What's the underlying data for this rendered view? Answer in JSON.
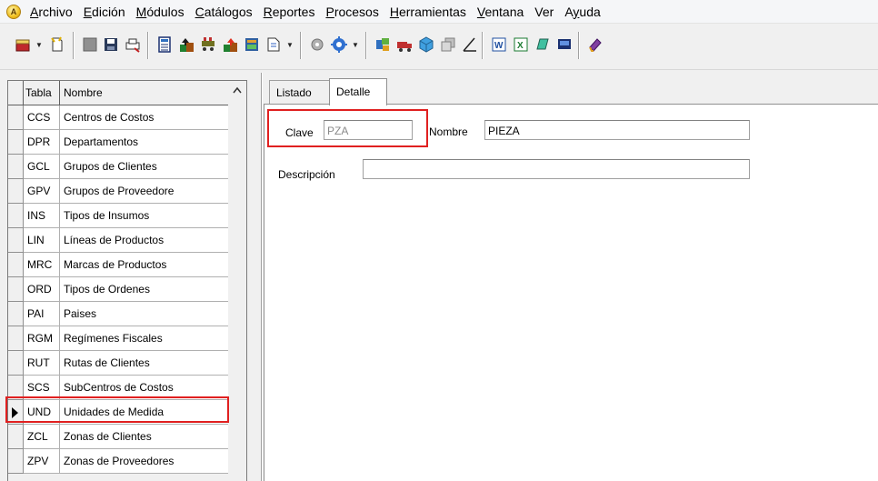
{
  "menu": {
    "items": [
      {
        "label": "Archivo",
        "underline": "A",
        "rest": "rchivo"
      },
      {
        "label": "Edición",
        "underline": "E",
        "rest": "dición"
      },
      {
        "label": "Módulos",
        "underline": "M",
        "rest": "ódulos"
      },
      {
        "label": "Catálogos",
        "underline": "C",
        "rest": "atálogos"
      },
      {
        "label": "Reportes",
        "underline": "R",
        "rest": "eportes"
      },
      {
        "label": "Procesos",
        "underline": "P",
        "rest": "rocesos"
      },
      {
        "label": "Herramientas",
        "underline": "H",
        "rest": "erramientas"
      },
      {
        "label": "Ventana",
        "underline": "V",
        "rest": "entana"
      },
      {
        "label": "Ver",
        "underline": "",
        "rest": "Ver"
      },
      {
        "label": "Ayuda",
        "pre": "A",
        "underline": "y",
        "rest": "uda"
      }
    ]
  },
  "toolbar": {
    "icons": [
      "new-record-icon",
      "new-document-icon",
      "stop-icon",
      "save-icon",
      "print-icon",
      "calculator-icon",
      "import-icon",
      "cart-icon",
      "export-icon",
      "report-icon",
      "document-icon",
      "settings-icon",
      "gear-icon",
      "tools-icon",
      "truck-icon",
      "cube-icon",
      "copy-icon",
      "edit-icon",
      "word-icon",
      "excel-icon",
      "notes-icon",
      "screen-icon",
      "help-icon"
    ]
  },
  "grid": {
    "header": {
      "col1": "Tabla",
      "col2": "Nombre"
    },
    "rows": [
      {
        "code": "CCS",
        "name": "Centros de Costos"
      },
      {
        "code": "DPR",
        "name": "Departamentos"
      },
      {
        "code": "GCL",
        "name": "Grupos de Clientes"
      },
      {
        "code": "GPV",
        "name": "Grupos de Proveedore"
      },
      {
        "code": "INS",
        "name": "Tipos de Insumos"
      },
      {
        "code": "LIN",
        "name": "Líneas de Productos"
      },
      {
        "code": "MRC",
        "name": "Marcas de Productos"
      },
      {
        "code": "ORD",
        "name": "Tipos de Ordenes"
      },
      {
        "code": "PAI",
        "name": "Paises"
      },
      {
        "code": "RGM",
        "name": "Regímenes Fiscales"
      },
      {
        "code": "RUT",
        "name": "Rutas de Clientes"
      },
      {
        "code": "SCS",
        "name": "SubCentros de Costos"
      },
      {
        "code": "UND",
        "name": "Unidades de Medida",
        "selected": true
      },
      {
        "code": "ZCL",
        "name": "Zonas de Clientes"
      },
      {
        "code": "ZPV",
        "name": "Zonas de Proveedores"
      }
    ]
  },
  "tabs": [
    {
      "label": "Listado",
      "active": false
    },
    {
      "label": "Detalle",
      "active": true
    }
  ],
  "form": {
    "clave_label": "Clave",
    "clave_value": "PZA",
    "nombre_label": "Nombre",
    "nombre_value": "PIEZA",
    "descripcion_label": "Descripción",
    "descripcion_value": ""
  },
  "colors": {
    "highlight": "#e02020",
    "window_bg": "#f0f0f0"
  }
}
